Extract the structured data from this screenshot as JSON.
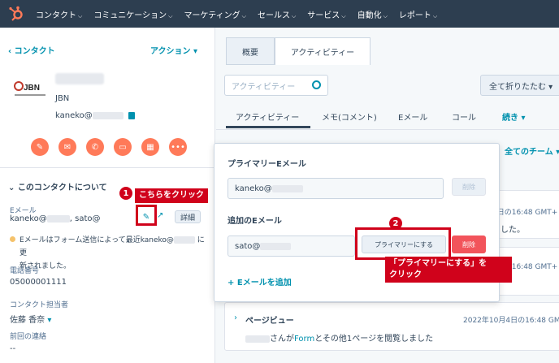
{
  "nav": {
    "items": [
      "コンタクト",
      "コミュニケーション",
      "マーケティング",
      "セールス",
      "サービス",
      "自動化",
      "レポート"
    ]
  },
  "left": {
    "back": "‹ コンタクト",
    "actions": "アクション ▾",
    "company": "JBN",
    "email_prefix": "kaneko@",
    "about_title": "このコンタクトについて",
    "email_label": "Eメール",
    "email_value_a": "kaneko@",
    "email_value_b": ", sato@",
    "detail_button": "詳細",
    "warn_text_1": "Eメールはフォーム送信によって最近kaneko@",
    "warn_text_2": "に更",
    "warn_text_3": "新されました。",
    "phone_label": "電話番号",
    "phone_value": "05000001111",
    "owner_label": "コンタクト担当者",
    "owner_value": "佐藤 香奈",
    "last_contact_label": "前回の連絡",
    "last_contact_value": "--"
  },
  "callouts": {
    "badge1": "1",
    "callout1": "こちらをクリック",
    "badge2": "2",
    "callout2_line1": "「プライマリーにする」を",
    "callout2_line2": "クリック"
  },
  "right": {
    "tab_overview": "概要",
    "tab_activity": "アクティビティー",
    "search_placeholder": "アクティビティー",
    "collapse_all": "全て折りたたむ ▾",
    "subtabs": [
      "アクティビティー",
      "メモ(コメント)",
      "Eメール",
      "コール",
      "続き ▾"
    ],
    "all_teams": "全てのチーム ▾",
    "stamp1": "2022年10月4日の16:49 GMT+",
    "stamp1_text": "ました。",
    "stamp2": "4日の16:48 GMT+",
    "pageview_title": "ページビュー",
    "stamp3": "2022年10月4日の16:48 GMT+",
    "pageview_text_pre": "さんが",
    "pageview_link": "Form",
    "pageview_text_post": "とその他1ページを閲覧しました"
  },
  "popup": {
    "primary_heading": "プライマリーEメール",
    "primary_value": "kaneko@",
    "delete_disabled": "削除",
    "additional_heading": "追加のEメール",
    "additional_value": "sato@",
    "make_primary": "プライマリーにする",
    "delete": "削除",
    "add_email": "+ Eメールを追加"
  }
}
